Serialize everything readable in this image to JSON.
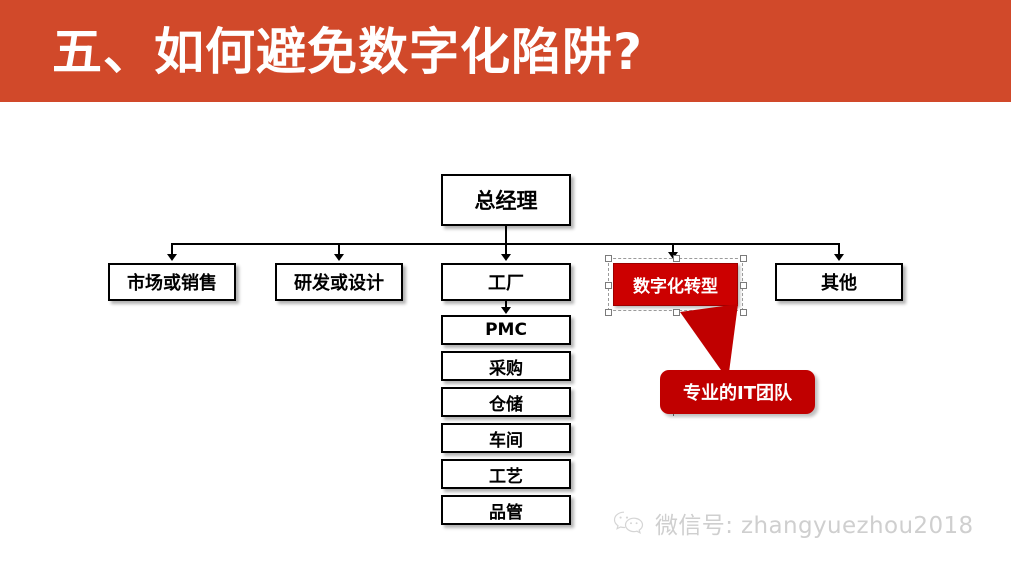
{
  "slide": {
    "title": "五、如何避免数字化陷阱?",
    "banner_color": "#d1492a"
  },
  "org_chart": {
    "root": {
      "label": "总经理"
    },
    "level2": [
      {
        "id": "sales",
        "label": "市场或销售"
      },
      {
        "id": "rd",
        "label": "研发或设计"
      },
      {
        "id": "factory",
        "label": "工厂"
      },
      {
        "id": "digital",
        "label": "数字化转型",
        "selected": true,
        "fill": "#cc0000"
      },
      {
        "id": "other",
        "label": "其他"
      }
    ],
    "factory_chain": [
      {
        "id": "pmc",
        "label": "PMC"
      },
      {
        "id": "buy",
        "label": "采购"
      },
      {
        "id": "store",
        "label": "仓储"
      },
      {
        "id": "shop",
        "label": "车间"
      },
      {
        "id": "craft",
        "label": "工艺"
      },
      {
        "id": "quality",
        "label": "品管"
      }
    ],
    "callout": {
      "label": "专业的IT团队",
      "fill": "#c00000"
    }
  },
  "footer": {
    "wechat_label": "微信号: zhangyuezhou2018",
    "icon": "wechat-icon",
    "color": "#cfcfcf"
  }
}
